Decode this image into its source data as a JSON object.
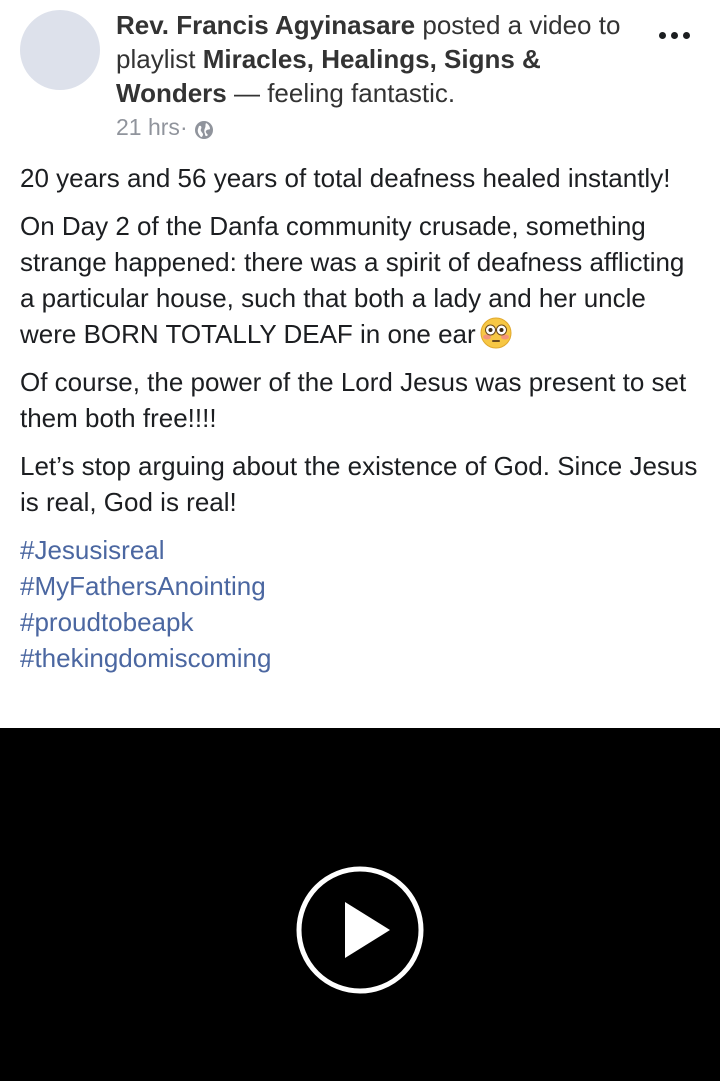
{
  "post": {
    "author": "Rev. Francis Agyinasare",
    "action": " posted a video to playlist ",
    "playlist": "Miracles, Healings, Signs & Wonders",
    "feeling": " —  feeling fantastic.",
    "time": "21 hrs",
    "separator": " · ",
    "privacy_icon": "globe-icon",
    "more_icon": "more-options-icon"
  },
  "content": {
    "paragraphs": [
      "20 years and 56 years of total deafness healed instantly!",
      "On Day 2 of the Danfa community crusade, something strange happened: there was a spirit of deafness afflicting a particular house, such that both a lady and her uncle were BORN TOTALLY DEAF in one ear",
      "Of course, the power of the Lord Jesus was present to set them both free!!!!",
      "Let’s stop arguing about the existence of God. Since Jesus is real, God is real!"
    ],
    "emoji": "flushed-face-emoji",
    "hashtags": [
      "#Jesusisreal",
      "#MyFathersAnointing",
      "#proudtobeapk",
      "#thekingdomiscoming"
    ]
  },
  "video": {
    "play_icon": "play-icon"
  },
  "colors": {
    "hashtag": "#4b67a1",
    "meta": "#90949c",
    "video_bg": "#000000"
  }
}
